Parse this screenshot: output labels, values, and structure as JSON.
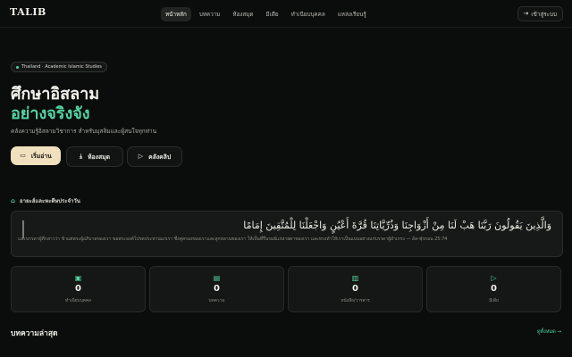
{
  "header": {
    "logo": "TALIB",
    "nav": [
      "หน้าหลัก",
      "บทความ",
      "ห้องสมุด",
      "มีเดีย",
      "ทำเนียบบุคคล",
      "แหล่งเรียนรู้"
    ],
    "login_label": "เข้าสู่ระบบ"
  },
  "hero": {
    "badge": "Thailand · Academic Islamic Studies",
    "title_line1": "ศึกษาอิสลาม",
    "title_line2": "อย่างจริงจัง",
    "subtitle": "คลังความรู้อิสลามวิชาการ สำหรับมุสลิมและผู้สนใจทุกท่าน",
    "buttons": {
      "read": "เริ่มอ่าน",
      "library": "ห้องสมุด",
      "clips": "คลังคลิป"
    }
  },
  "daily": {
    "heading": "อายะฮ์และหะดีษประจำวัน",
    "arabic": "وَالَّذِينَ يَقُولُونَ رَبَّنَا هَبْ لَنَا مِنْ أَزْوَاجِنَا وَذُرِّيَّاتِنَا قُرَّةَ أَعْيُنٍ وَاجْعَلْنَا لِلْمُتَّقِينَ إِمَامًا",
    "translation": "และบรรดาผู้ที่กล่าวว่า ข้าแต่พระผู้อภิบาลของเรา ขอพระองค์โปรดประทานแก่เรา ซึ่งคู่ครองของเราและลูกหลานของเรา ให้เป็นที่รื่นรมย์แก่สายตาของเรา และทรงทำให้เราเป็นแบบอย่างแก่บรรดาผู้ยำเกรง — อัล-ฟุรกอน 25:74"
  },
  "stats": [
    {
      "icon": "person-icon",
      "value": "0",
      "label": "ทำเนียบบุคคล"
    },
    {
      "icon": "article-icon",
      "value": "0",
      "label": "บทความ"
    },
    {
      "icon": "book-icon",
      "value": "0",
      "label": "หนังสือ/วารสาร"
    },
    {
      "icon": "play-icon",
      "value": "0",
      "label": "มีเดีย"
    }
  ],
  "latest": {
    "heading": "บทความล่าสุด",
    "see_all": "ดูทั้งหมด →"
  },
  "colors": {
    "accent": "#52d4a2",
    "primary_button": "#f0e0bd",
    "background": "#0b0c0c"
  }
}
